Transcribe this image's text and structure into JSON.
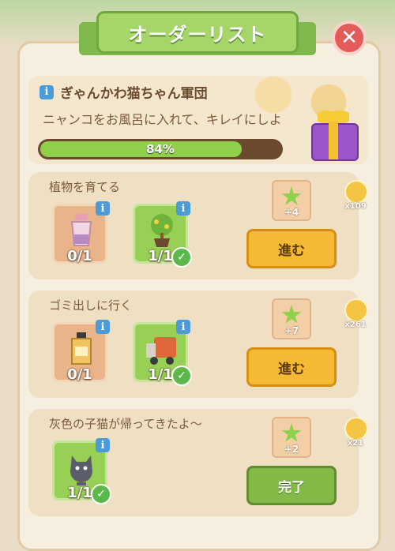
{
  "header": {
    "title": "オーダーリスト",
    "close_icon": "close-icon"
  },
  "event": {
    "title": "ぎゃんかわ猫ちゃん軍団",
    "description": "ニャンコをお風呂に入れて、キレイにしよ",
    "progress_percent": 84,
    "progress_label": "84%"
  },
  "orders": [
    {
      "title": "植物を育てる",
      "items": [
        {
          "icon": "bottle-icon",
          "count": "0/1",
          "state": "need"
        },
        {
          "icon": "potted-tree-icon",
          "count": "1/1",
          "state": "done"
        }
      ],
      "reward": "+4",
      "coin_multiplier": "x109",
      "button": "進む",
      "button_state": "go"
    },
    {
      "title": "ゴミ出しに行く",
      "items": [
        {
          "icon": "jar-icon",
          "count": "0/1",
          "state": "need"
        },
        {
          "icon": "garbage-truck-icon",
          "count": "1/1",
          "state": "done"
        }
      ],
      "reward": "+7",
      "coin_multiplier": "x261",
      "button": "進む",
      "button_state": "go"
    },
    {
      "title": "灰色の子猫が帰ってきたよ〜",
      "items": [
        {
          "icon": "gray-kitten-icon",
          "count": "1/1",
          "state": "done"
        }
      ],
      "reward": "+2",
      "coin_multiplier": "x21",
      "button": "完了",
      "button_state": "complete"
    }
  ],
  "colors": {
    "banner_green": "#a6d66a",
    "progress_green": "#8fcf4a",
    "go_button": "#f5b934",
    "complete_button": "#84b947",
    "close_red": "#e45c5a"
  }
}
